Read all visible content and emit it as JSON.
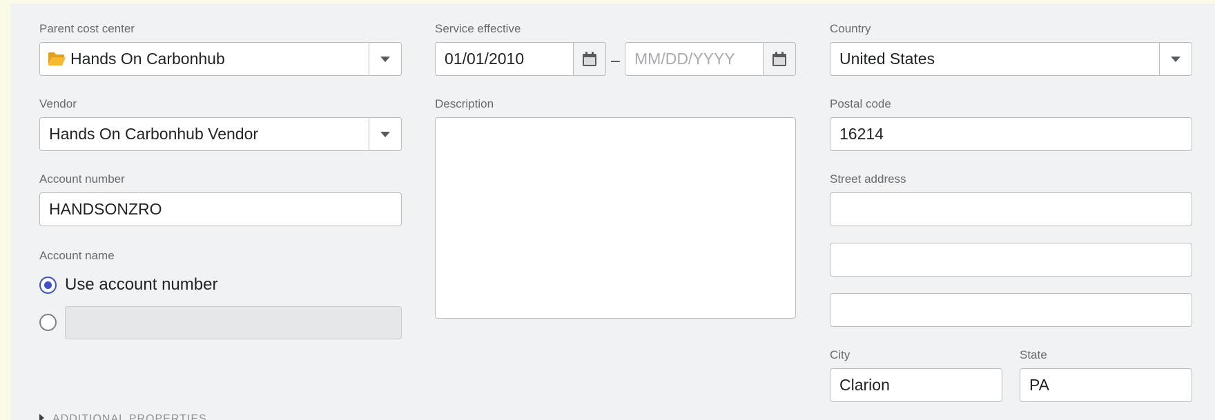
{
  "form": {
    "parent_cost_center": {
      "label": "Parent cost center",
      "value": "Hands On Carbonhub",
      "icon": "folder-icon",
      "icon_color": "#f5b82e"
    },
    "vendor": {
      "label": "Vendor",
      "value": "Hands On Carbonhub Vendor"
    },
    "account_number": {
      "label": "Account number",
      "value": "HANDSONZRO"
    },
    "account_name": {
      "label": "Account name",
      "option_use_number": "Use account number",
      "selected": "use_account_number",
      "custom_value": ""
    },
    "service_effective": {
      "label": "Service effective",
      "start_value": "01/01/2010",
      "separator": "–",
      "end_value": "",
      "end_placeholder": "MM/DD/YYYY"
    },
    "description": {
      "label": "Description",
      "value": ""
    },
    "country": {
      "label": "Country",
      "value": "United States"
    },
    "postal_code": {
      "label": "Postal code",
      "value": "16214"
    },
    "street_address": {
      "label": "Street address",
      "line1": "",
      "line2": "",
      "line3": ""
    },
    "city": {
      "label": "City",
      "value": "Clarion"
    },
    "state": {
      "label": "State",
      "value": "PA"
    },
    "additional_properties": {
      "label": "ADDITIONAL PROPERTIES",
      "expanded": false
    }
  },
  "colors": {
    "accent": "#3f51c4",
    "page_background": "#fafae8",
    "panel_background": "#f1f2f4"
  }
}
